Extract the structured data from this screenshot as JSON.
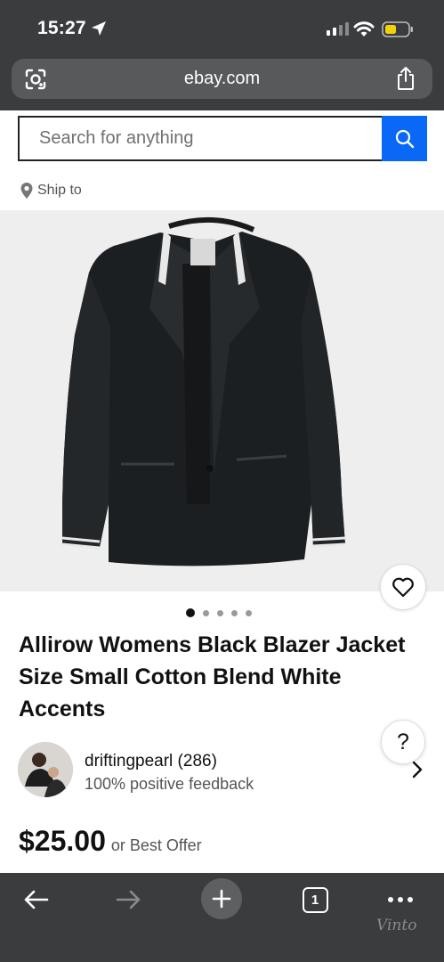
{
  "status_bar": {
    "time": "15:27"
  },
  "browser": {
    "url": "ebay.com"
  },
  "search": {
    "placeholder": "Search for anything"
  },
  "ship_to": {
    "label": "Ship to"
  },
  "listing": {
    "title": "Allirow Womens Black Blazer Jacket Size Small Cotton Blend White Accents",
    "image_count": 5,
    "active_image": 1,
    "price": "$25.00",
    "price_suffix": "or Best Offer"
  },
  "seller": {
    "name": "driftingpearl (286)",
    "feedback": "100% positive feedback"
  },
  "help": {
    "label": "?"
  },
  "toolbar": {
    "tab_count": "1"
  },
  "watermark": "Vinto",
  "colors": {
    "accent": "#0968f6",
    "chrome": "#3b3c3e",
    "battery": "#f2d20a"
  },
  "icons": [
    "location-arrow-icon",
    "signal-icon",
    "wifi-icon",
    "battery-icon",
    "lens-icon",
    "share-icon",
    "search-icon",
    "location-pin-icon",
    "heart-icon",
    "chevron-right-icon",
    "back-icon",
    "forward-icon",
    "plus-icon",
    "tabs-icon",
    "more-icon"
  ]
}
